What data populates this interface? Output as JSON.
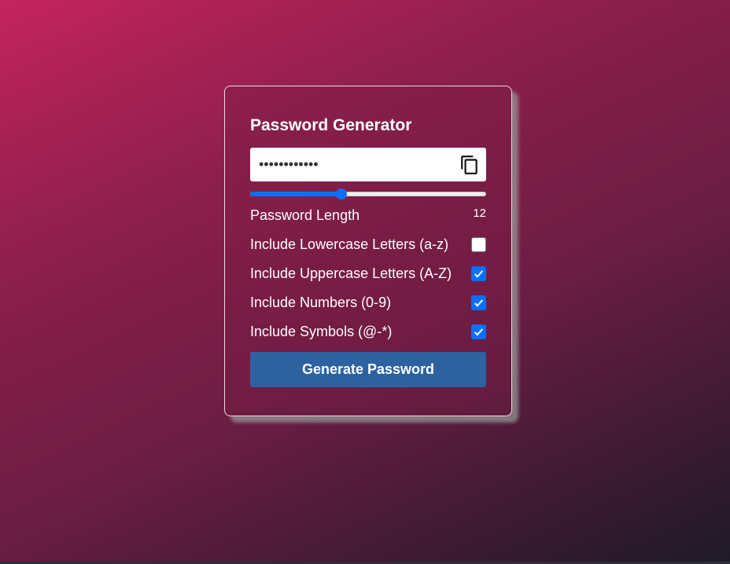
{
  "card": {
    "title": "Password Generator",
    "password_masked": "••••••••••••",
    "copy_icon": "copy-icon",
    "length": {
      "label": "Password Length",
      "value": "12",
      "slider_fraction": 0.385
    },
    "options": [
      {
        "label": "Include Lowercase Letters (a-z)",
        "checked": false
      },
      {
        "label": "Include Uppercase Letters (A-Z)",
        "checked": true
      },
      {
        "label": "Include Numbers (0-9)",
        "checked": true
      },
      {
        "label": "Include Symbols (@-*)",
        "checked": true
      }
    ],
    "generate_label": "Generate Password"
  },
  "colors": {
    "accent": "#0d6efd",
    "button": "#2d62a0"
  }
}
